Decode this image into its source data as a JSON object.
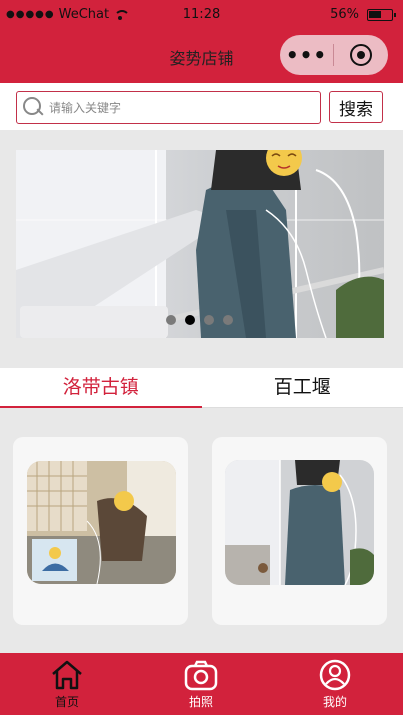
{
  "status_bar": {
    "signal": "●●●●●",
    "carrier": "WeChat",
    "time": "11:28",
    "battery": "56%",
    "battery_level": 0.56
  },
  "header": {
    "title": "姿势店铺",
    "more_icon": "more-dots-icon",
    "close_icon": "target-circle-icon"
  },
  "search": {
    "placeholder": "请输入关键字",
    "value": "",
    "button_label": "搜索"
  },
  "banner": {
    "slide_count": 4,
    "active_index": 1
  },
  "tabs": [
    {
      "label": "洛带古镇",
      "active": true
    },
    {
      "label": "百工堰",
      "active": false
    }
  ],
  "cards": [
    {
      "image": "photo-card-1"
    },
    {
      "image": "photo-card-2"
    }
  ],
  "bottom_nav": [
    {
      "label": "首页",
      "icon": "home-icon"
    },
    {
      "label": "拍照",
      "icon": "camera-icon"
    },
    {
      "label": "我的",
      "icon": "user-icon"
    }
  ],
  "colors": {
    "brand": "#d2223c",
    "capsule": "#ecbcc4"
  }
}
